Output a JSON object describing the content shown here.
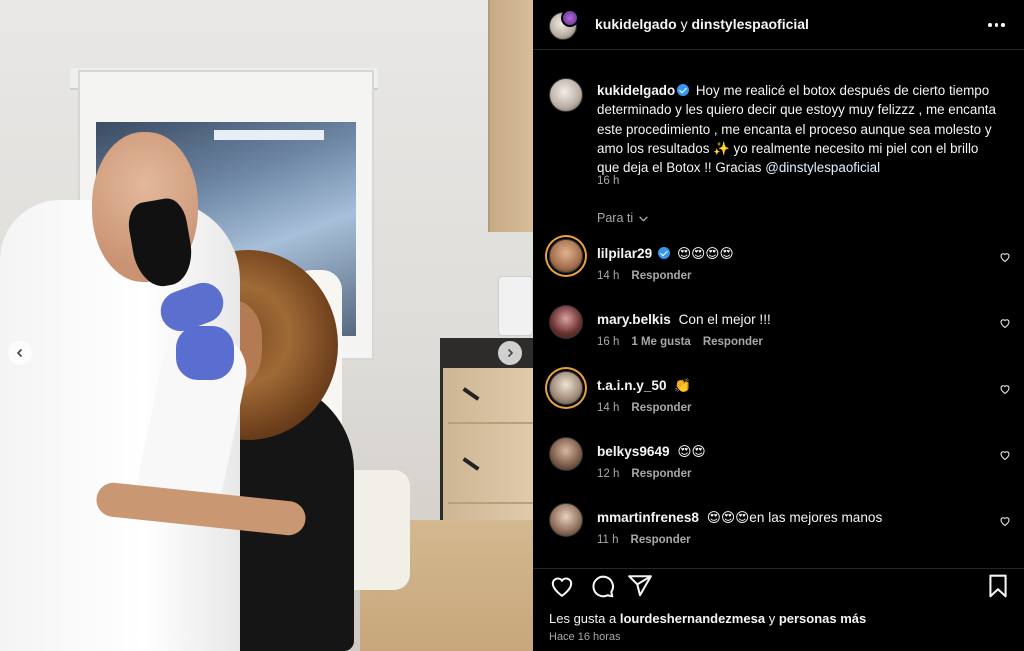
{
  "header": {
    "author": "kukidelgado",
    "connector": "y",
    "collaborator": "dinstylespaoficial"
  },
  "caption": {
    "author": "kukidelgado",
    "text": "Hoy me realicé el botox después de cierto tiempo determinado y les quiero decir que estoyy muy felizzz , me encanta este procedimiento , me encanta el proceso aunque sea molesto y amo los resultados ✨ yo realmente necesito mi piel con el brillo que deja el Botox !! Gracias",
    "mention": "@dinstylespaoficial",
    "time": "16 h"
  },
  "sort_label": "Para ti",
  "comments": [
    {
      "user": "lilpilar29",
      "text": "😍😍😍😍",
      "time": "14 h",
      "likes": "",
      "reply": "Responder"
    },
    {
      "user": "mary.belkis",
      "text": "Con el mejor !!!",
      "time": "16 h",
      "likes": "1 Me gusta",
      "reply": "Responder"
    },
    {
      "user": "t.a.i.n.y_50",
      "text": "👏",
      "time": "14 h",
      "likes": "",
      "reply": "Responder"
    },
    {
      "user": "belkys9649",
      "text": "😍😍",
      "time": "12 h",
      "likes": "",
      "reply": "Responder"
    },
    {
      "user": "mmartinfrenes8",
      "text": "😍😍😍en las mejores manos",
      "time": "11 h",
      "likes": "",
      "reply": "Responder"
    }
  ],
  "likes_line": {
    "prefix": "Les gusta a",
    "user": "lourdeshernandezmesa",
    "middle": "y",
    "others": "personas más"
  },
  "post_date": "Hace 16 horas",
  "icons": [
    "more-icon",
    "verified-icon",
    "chevron-down-icon",
    "heart-icon",
    "comment-icon",
    "share-icon",
    "bookmark-icon",
    "chevron-left-icon",
    "chevron-right-icon"
  ]
}
